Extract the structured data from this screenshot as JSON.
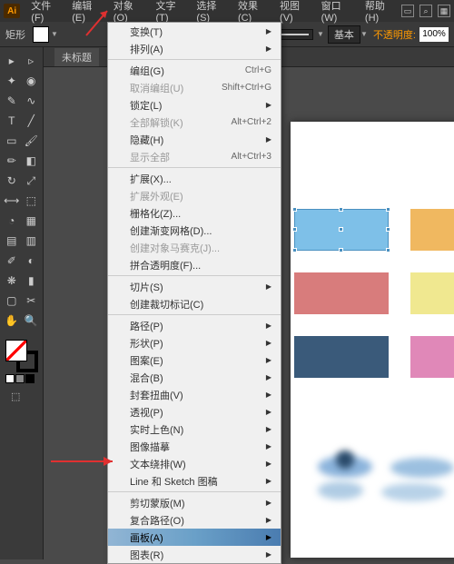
{
  "app": {
    "icon_label": "Ai"
  },
  "menubar": {
    "items": [
      "文件(F)",
      "编辑(E)",
      "对象(O)",
      "文字(T)",
      "选择(S)",
      "效果(C)",
      "视图(V)",
      "窗口(W)",
      "帮助(H)"
    ]
  },
  "controlbar": {
    "shape_label": "矩形",
    "basic_label": "基本",
    "opacity_label": "不透明度:",
    "opacity_value": "100%"
  },
  "tabbar": {
    "tab_label": "未标题"
  },
  "dropdown": {
    "groups": [
      [
        {
          "label": "变换(T)",
          "submenu": true
        },
        {
          "label": "排列(A)",
          "submenu": true
        }
      ],
      [
        {
          "label": "编组(G)",
          "shortcut": "Ctrl+G"
        },
        {
          "label": "取消编组(U)",
          "shortcut": "Shift+Ctrl+G",
          "disabled": true
        },
        {
          "label": "锁定(L)",
          "submenu": true
        },
        {
          "label": "全部解锁(K)",
          "shortcut": "Alt+Ctrl+2",
          "disabled": true
        },
        {
          "label": "隐藏(H)",
          "submenu": true
        },
        {
          "label": "显示全部",
          "shortcut": "Alt+Ctrl+3",
          "disabled": true
        }
      ],
      [
        {
          "label": "扩展(X)..."
        },
        {
          "label": "扩展外观(E)",
          "disabled": true
        },
        {
          "label": "栅格化(Z)..."
        },
        {
          "label": "创建渐变网格(D)..."
        },
        {
          "label": "创建对象马赛克(J)...",
          "disabled": true
        },
        {
          "label": "拼合透明度(F)..."
        }
      ],
      [
        {
          "label": "切片(S)",
          "submenu": true
        },
        {
          "label": "创建裁切标记(C)"
        }
      ],
      [
        {
          "label": "路径(P)",
          "submenu": true
        },
        {
          "label": "形状(P)",
          "submenu": true
        },
        {
          "label": "图案(E)",
          "submenu": true
        },
        {
          "label": "混合(B)",
          "submenu": true
        },
        {
          "label": "封套扭曲(V)",
          "submenu": true
        },
        {
          "label": "透视(P)",
          "submenu": true
        },
        {
          "label": "实时上色(N)",
          "submenu": true
        },
        {
          "label": "图像描摹",
          "submenu": true
        },
        {
          "label": "文本绕排(W)",
          "submenu": true
        },
        {
          "label": "Line 和 Sketch 图稿",
          "submenu": true
        }
      ],
      [
        {
          "label": "剪切蒙版(M)",
          "submenu": true
        },
        {
          "label": "复合路径(O)",
          "submenu": true
        },
        {
          "label": "画板(A)",
          "submenu": true,
          "highlighted": true
        },
        {
          "label": "图表(R)",
          "submenu": true
        }
      ]
    ]
  },
  "colors": {
    "selected_block": "#7ec0e8",
    "block_orange": "#f0b860",
    "block_red": "#d87c7c",
    "block_yellow": "#f0e890",
    "block_navy": "#3a5a7a",
    "block_pink": "#e088b8"
  }
}
